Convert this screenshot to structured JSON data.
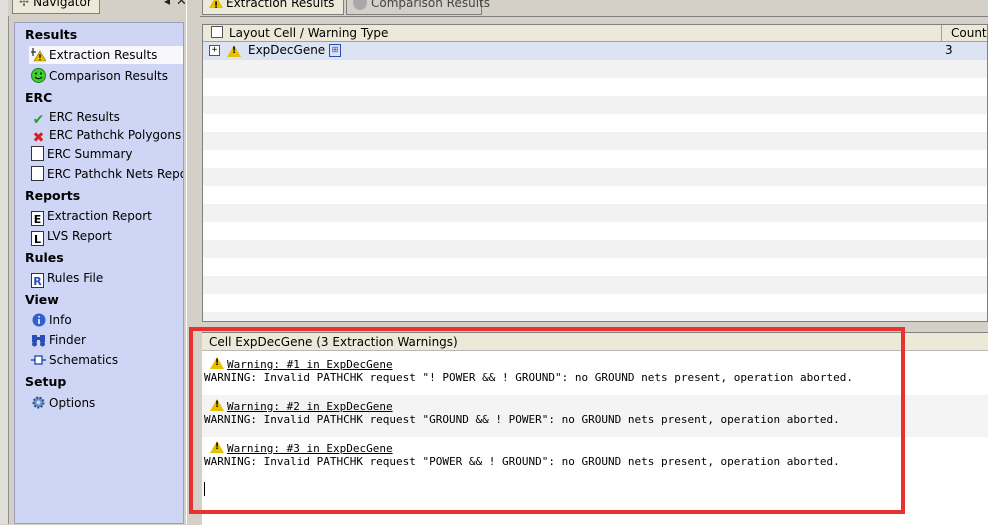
{
  "navigator": {
    "tab_label": "Navigator",
    "collapse_glyph": "◂",
    "close_glyph": "✕",
    "sections": [
      {
        "title": "Results",
        "items": [
          {
            "label": "Extraction Results",
            "icon": "extraction-warning-icon",
            "selected": true
          },
          {
            "label": "Comparison Results",
            "icon": "smiley-icon"
          }
        ]
      },
      {
        "title": "ERC",
        "items": [
          {
            "label": "ERC Results",
            "icon": "checkmark-icon"
          },
          {
            "label": "ERC Pathchk Polygons",
            "icon": "red-x-icon"
          },
          {
            "label": "ERC Summary",
            "icon": "document-icon"
          },
          {
            "label": "ERC Pathchk Nets Repo",
            "icon": "document-icon"
          }
        ]
      },
      {
        "title": "Reports",
        "items": [
          {
            "label": "Extraction Report",
            "icon": "report-e-icon"
          },
          {
            "label": "LVS Report",
            "icon": "report-l-icon"
          }
        ]
      },
      {
        "title": "Rules",
        "items": [
          {
            "label": "Rules File",
            "icon": "rules-file-icon"
          }
        ]
      },
      {
        "title": "View",
        "items": [
          {
            "label": "Info",
            "icon": "info-icon"
          },
          {
            "label": "Finder",
            "icon": "binoculars-icon"
          },
          {
            "label": "Schematics",
            "icon": "schematic-icon"
          }
        ]
      },
      {
        "title": "Setup",
        "items": [
          {
            "label": "Options",
            "icon": "gear-icon"
          }
        ]
      }
    ]
  },
  "tabs": [
    {
      "label": "Extraction Results",
      "icon": "warning-icon",
      "active": true
    },
    {
      "label": "Comparison Results",
      "icon": "smiley-icon",
      "active": false
    }
  ],
  "table": {
    "columns": [
      "Layout Cell / Warning Type",
      "Count"
    ],
    "rows": [
      {
        "expand": "+",
        "cell": "ExpDecGene",
        "count": "3"
      }
    ]
  },
  "details": {
    "header": "Cell ExpDecGene (3 Extraction Warnings)",
    "warnings": [
      {
        "title": "Warning: #1 in ExpDecGene",
        "message": "WARNING: Invalid PATHCHK request \"! POWER && ! GROUND\": no GROUND nets present, operation aborted."
      },
      {
        "title": "Warning: #2 in ExpDecGene",
        "message": "WARNING: Invalid PATHCHK request \"GROUND && ! POWER\": no GROUND nets present, operation aborted."
      },
      {
        "title": "Warning: #3 in ExpDecGene",
        "message": "WARNING: Invalid PATHCHK request \"POWER && ! GROUND\": no GROUND nets present, operation aborted."
      }
    ]
  },
  "colors": {
    "highlight_box": "#e8322e",
    "navigator_bg": "#cfd6f5",
    "selected_row": "#dce4f4"
  }
}
